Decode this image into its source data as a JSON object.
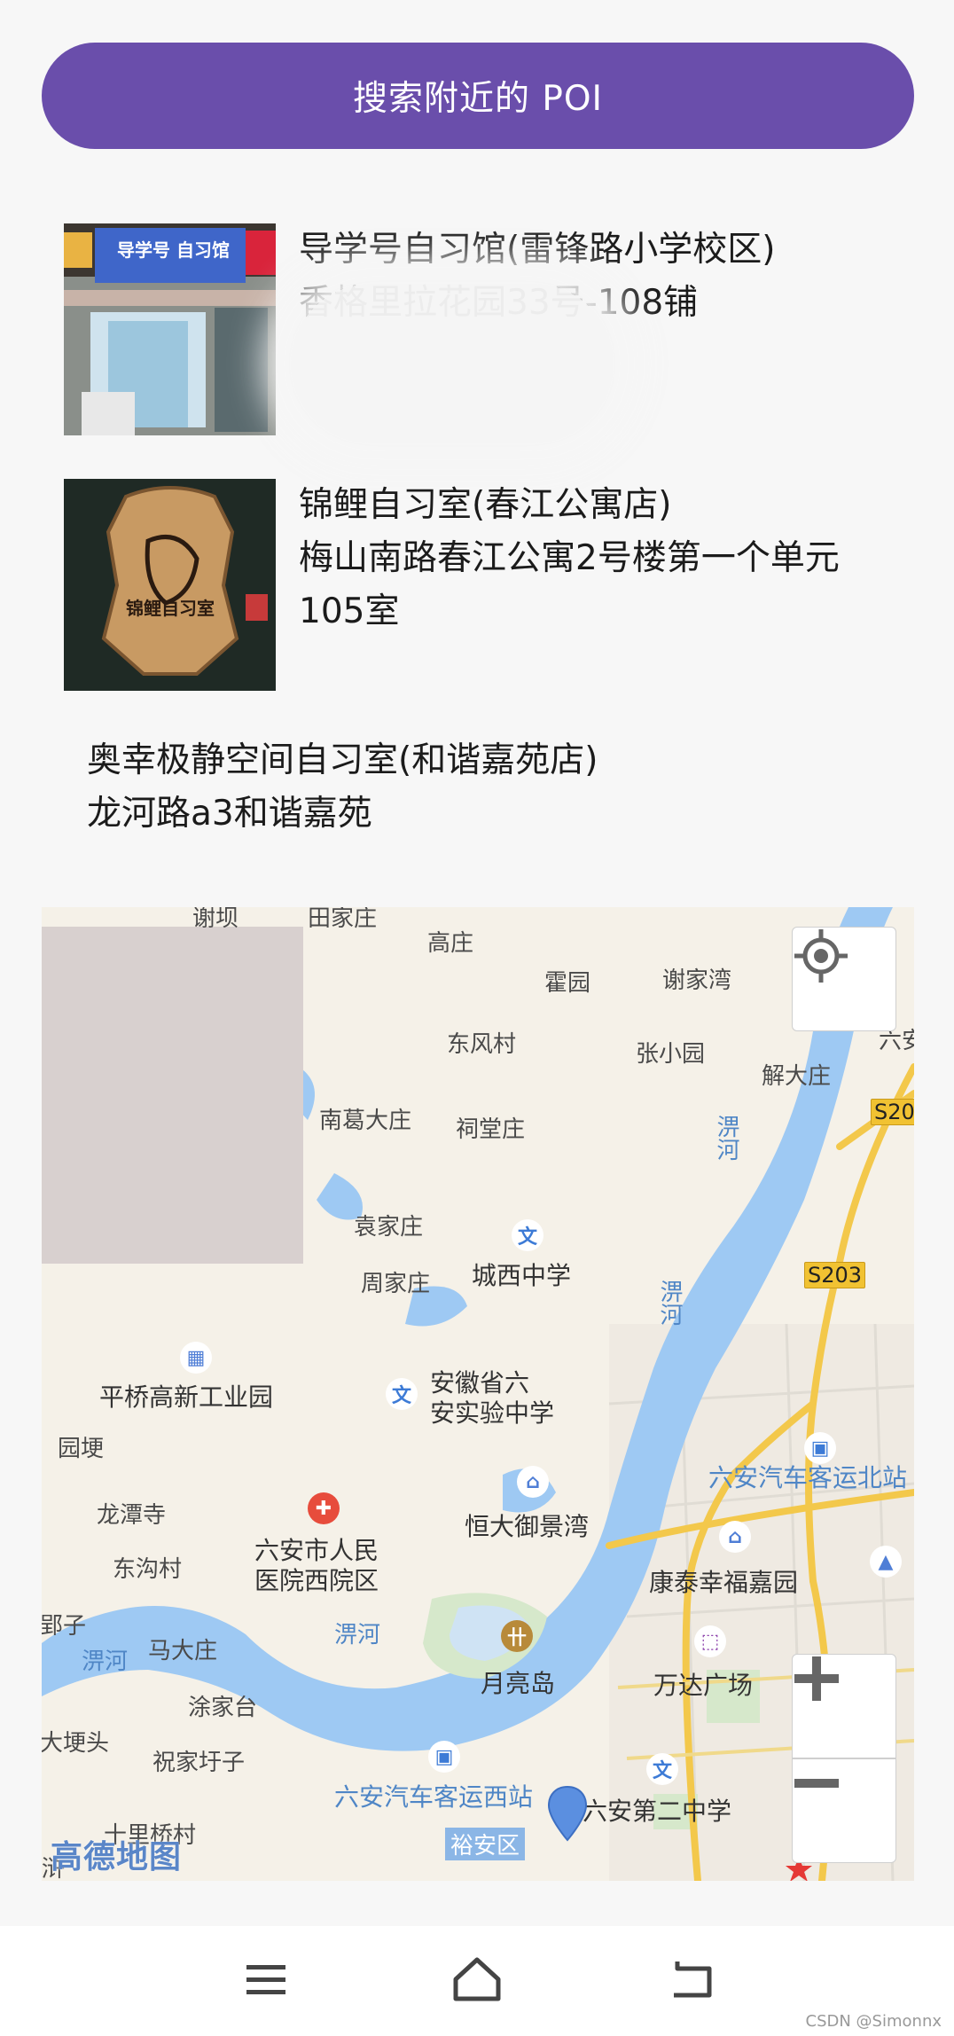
{
  "search_button_label": "搜索附近的 POI",
  "pois": [
    {
      "name": "导学号自习馆(雷锋路小学校区)",
      "address": "香格里拉花园33号-108铺",
      "image_sign_text": "导学号 自习馆"
    },
    {
      "name": "锦鲤自习室(春江公寓店)",
      "address_line1": "梅山南路春江公寓2号楼第一个单元",
      "address_line2": "105室",
      "image_sign_text": "锦鲤自习室"
    },
    {
      "name": "奥幸极静空间自习室(和谐嘉苑店)",
      "address": "龙河路a3和谐嘉苑"
    }
  ],
  "map": {
    "provider_logo": "高德地图",
    "labels": {
      "xiebian": "谢坝",
      "tianjiazhuang": "田家庄",
      "gaozhuang": "高庄",
      "huoyuan": "霍园",
      "xiejiawan": "谢家湾",
      "dongfengcun": "东风村",
      "zhangxiaoyuan": "张小园",
      "jiedazhuang": "解大庄",
      "nangedazhuang": "南葛大庄",
      "citangzhuang": "祠堂庄",
      "pi_river_1": "淠河",
      "yuanjiazhuang": "袁家庄",
      "chengxi_school": "城西中学",
      "zhoujiazhuang": "周家庄",
      "pi_river_2": "淠河",
      "pingqiao": "平桥高新工业园",
      "anhui_school_1": "安徽省六",
      "anhui_school_2": "安实验中学",
      "yuangeng": "园埂",
      "bus_north": "六安汽车客运北站",
      "longtansi": "龙潭寺",
      "hengda": "恒大御景湾",
      "hospital_1": "六安市人民",
      "hospital_2": "医院西院区",
      "dongguocun": "东沟村",
      "kangtai": "康泰幸福嘉园",
      "pi_river_3": "淠河",
      "madazhuang": "马大庄",
      "pi_river_4": "淠河",
      "yueliangdao": "月亮岛",
      "wanda": "万达广场",
      "tujiatai": "涂家台",
      "dagengtou": "大埂头",
      "zhujiayuzi": "祝家圩子",
      "bus_west": "六安汽车客运西站",
      "no2_school": "六安第二中学",
      "yuan_district": "裕安区",
      "shiliqiao": "十里桥村",
      "edge_liu": "六安",
      "edge_zi": "郢子",
      "edge_pu": "浒"
    },
    "road_labels": {
      "s20": "S20",
      "s203": "S203"
    },
    "colors": {
      "water": "#9ec9f3",
      "land": "#f5f1e8",
      "road": "#f3c84b"
    }
  },
  "watermark": "CSDN @Simonnx"
}
